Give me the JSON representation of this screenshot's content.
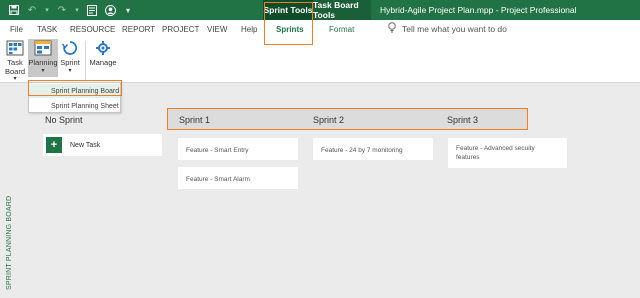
{
  "titlebar": {
    "context_tab_sprint_tools": "Sprint Tools",
    "context_tab_task_board_tools": "Task Board Tools",
    "document_title": "Hybrid-Agile Project Plan.mpp  -  Project Professional",
    "qat_icons": [
      "save-icon",
      "undo-icon",
      "redo-icon",
      "touch-mode-icon",
      "user-icon",
      "customize-qat-icon"
    ]
  },
  "tabs": {
    "file": "File",
    "task": "TASK",
    "resource": "RESOURCE",
    "report": "REPORT",
    "project": "PROJECT",
    "view": "VIEW",
    "help": "Help",
    "sprints": "Sprints",
    "format": "Format",
    "tell_me": "Tell me what you want to do"
  },
  "ribbon": {
    "task_board_line1": "Task",
    "task_board_line2": "Board",
    "planning": "Planning",
    "sprint": "Sprint",
    "manage": "Manage"
  },
  "planning_menu": {
    "item1": "Sprint Planning Board",
    "item2": "Sprint Planning Sheet"
  },
  "side_label": "SPRINT PLANNING BOARD",
  "board": {
    "no_sprint_header": "No Sprint",
    "new_task_label": "New Task",
    "sprint_headers": [
      "Sprint 1",
      "Sprint 2",
      "Sprint 3"
    ],
    "cards": {
      "smart_entry": "Feature - Smart Entry",
      "smart_alarm": "Feature - Smart Alarm",
      "monitoring": "Feature - 24 by 7 monitoring",
      "security_line1": "Feature - Advanced secuity",
      "security_line2": "features"
    }
  },
  "colors": {
    "brand_green": "#217346",
    "highlight_orange": "#f07f24"
  }
}
